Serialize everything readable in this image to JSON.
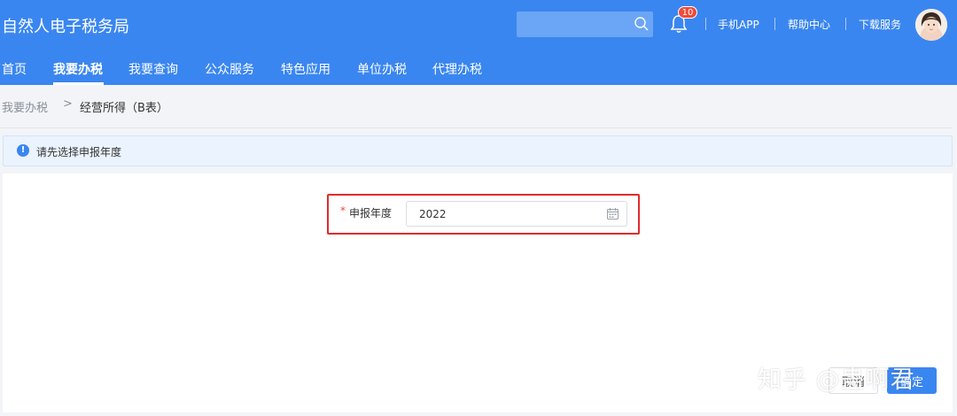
{
  "header": {
    "site_title": "自然人电子税务局",
    "search_placeholder": "",
    "notification_count": "10",
    "links": [
      "手机APP",
      "帮助中心",
      "下载服务"
    ]
  },
  "nav": {
    "items": [
      "首页",
      "我要办税",
      "我要查询",
      "公众服务",
      "特色应用",
      "单位办税",
      "代理办税"
    ],
    "active": "我要办税"
  },
  "breadcrumb": {
    "root": "我要办税",
    "separator": ">",
    "current": "经营所得（B表）"
  },
  "notice": {
    "text": "请先选择申报年度"
  },
  "form": {
    "required_mark": "*",
    "year_label": "申报年度",
    "year_value": "2022"
  },
  "footer": {
    "back_label": "取消",
    "next_label": "确定"
  },
  "watermark": "知乎 @蛊啊君",
  "colors": {
    "primary": "#3a86f0",
    "highlight": "#e02b2b",
    "badge": "#f04a3c"
  }
}
